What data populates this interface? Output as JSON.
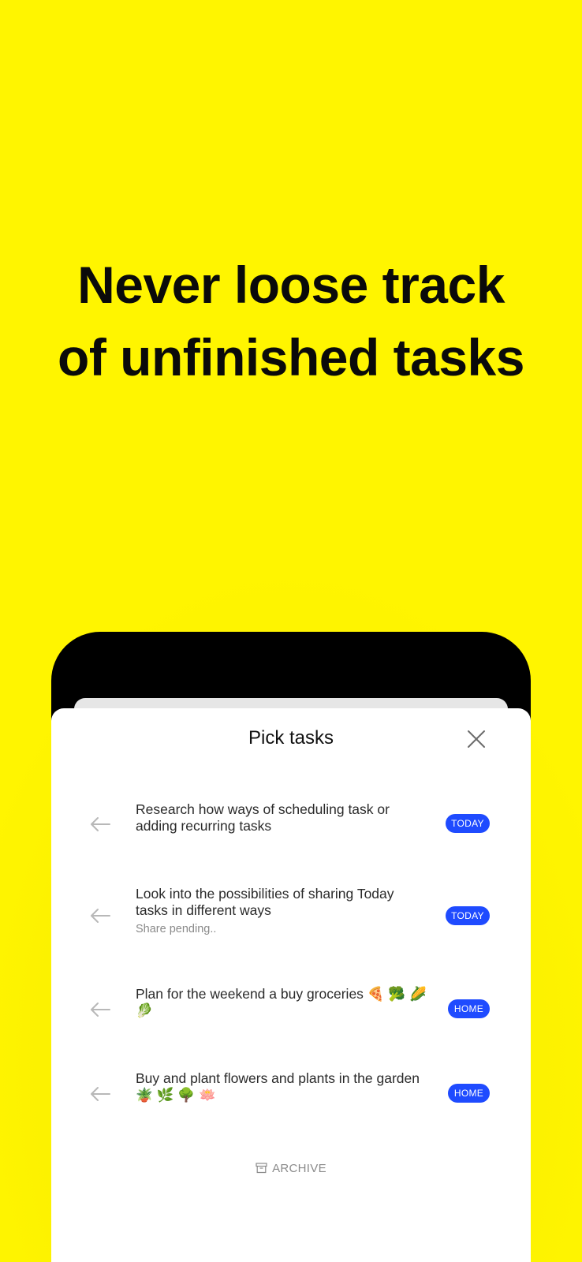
{
  "headline": {
    "line1": "Never loose track",
    "line2": "of unfinished tasks"
  },
  "sheet": {
    "title": "Pick tasks",
    "close_icon": "close-icon",
    "archive_label": "ARCHIVE",
    "archive_icon": "archive-box-icon"
  },
  "tasks": [
    {
      "line1": "Research how ways of scheduling task or",
      "line2": "adding recurring tasks",
      "sub": "",
      "tag": "TODAY"
    },
    {
      "line1": "Look into the possibilities of sharing Today",
      "line2": "tasks in different ways",
      "sub": "Share pending..",
      "tag": "TODAY"
    },
    {
      "line1": "Plan for the weekend a buy groceries 🍕 🥦 🌽",
      "line2": "🥬",
      "sub": "",
      "tag": "HOME"
    },
    {
      "line1": "Buy and plant flowers and plants in the garden",
      "line2": "🪴 🌿 🌳 🪷",
      "sub": "",
      "tag": "HOME"
    }
  ],
  "colors": {
    "background": "#FFF500",
    "tag": "#1F4BFF",
    "phone_frame": "#000000"
  }
}
